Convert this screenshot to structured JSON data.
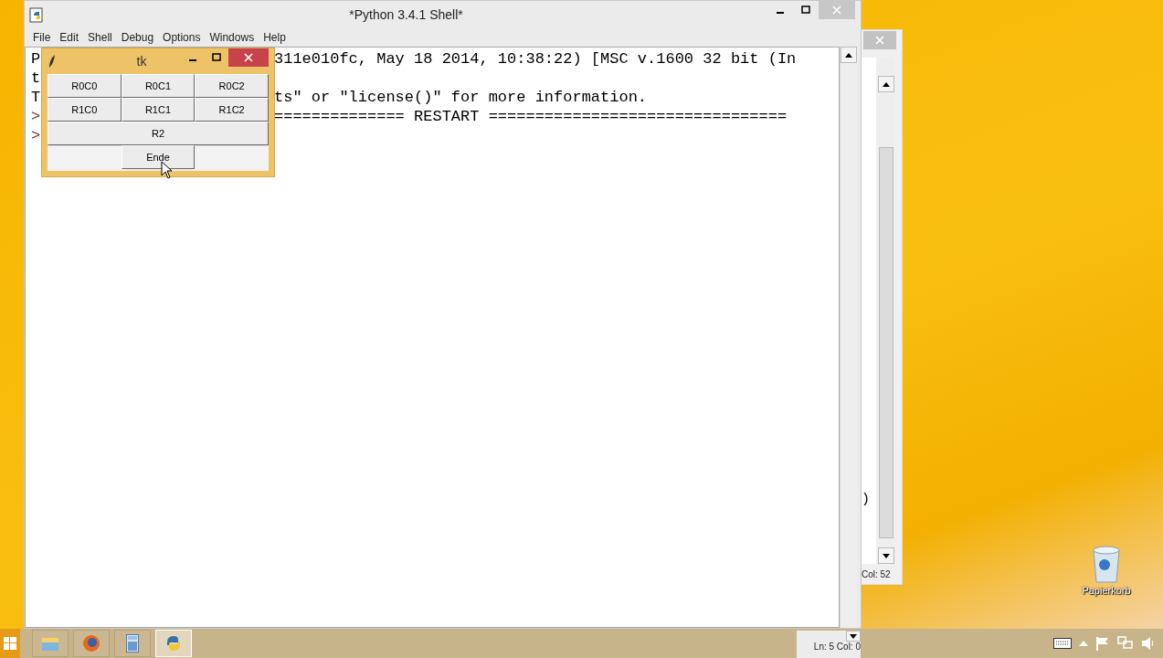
{
  "shell_window": {
    "title": "*Python 3.4.1 Shell*",
    "menu": [
      "File",
      "Edit",
      "Shell",
      "Debug",
      "Options",
      "Windows",
      "Help"
    ],
    "lines": [
      {
        "kind": "output",
        "left": "P",
        "right": "311e010fc, May 18 2014, 10:38:22) [MSC v.1600 32 bit (In"
      },
      {
        "kind": "output",
        "left": "t"
      },
      {
        "kind": "output",
        "left": "T",
        "right": "ts\" or \"license()\" for more information."
      },
      {
        "kind": "prompt",
        "left": ">",
        "right": "============== RESTART ================================"
      },
      {
        "kind": "prompt",
        "left": ">"
      }
    ],
    "status": "Ln: 5 Col: 0"
  },
  "tk_window": {
    "title": "tk",
    "buttons": [
      {
        "kind": "cell",
        "label": "R0C0"
      },
      {
        "kind": "cell",
        "label": "R0C1"
      },
      {
        "kind": "cell",
        "label": "R0C2"
      },
      {
        "kind": "cell",
        "label": "R1C0"
      },
      {
        "kind": "cell",
        "label": "R1C1"
      },
      {
        "kind": "cell",
        "label": "R1C2"
      },
      {
        "kind": "wide",
        "label": "R2"
      },
      {
        "kind": "centered",
        "label": "Ende"
      }
    ]
  },
  "back_window": {
    "text": ")",
    "status": "Col: 52"
  },
  "desktop": {
    "icons": [
      {
        "label": "Papierkorb"
      }
    ]
  },
  "taskbar": {
    "apps": [
      {
        "kind": "folder",
        "selected": false
      },
      {
        "kind": "firefox",
        "selected": false
      },
      {
        "kind": "calculator",
        "selected": false
      },
      {
        "kind": "python",
        "selected": true
      }
    ]
  }
}
